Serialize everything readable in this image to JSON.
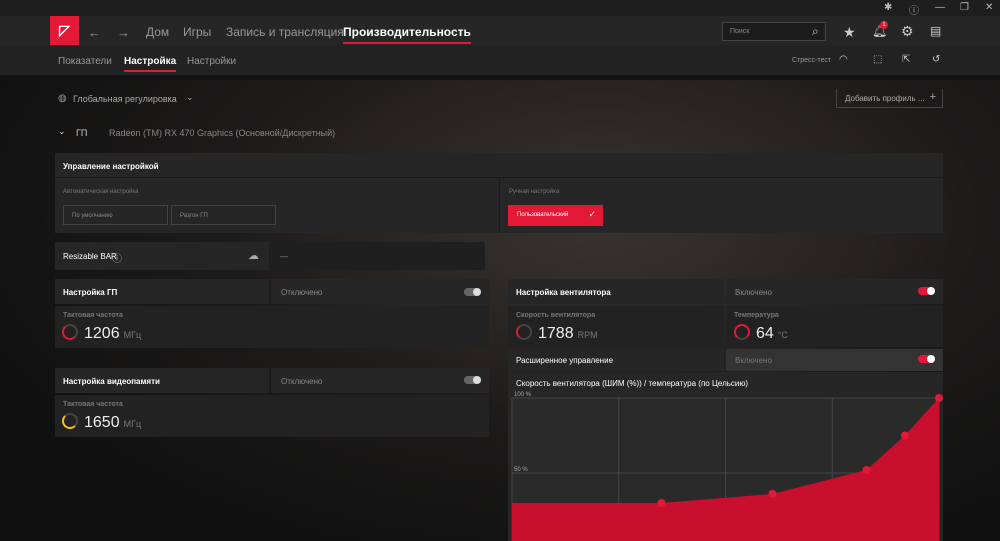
{
  "window": {
    "icons": [
      "bug-icon",
      "help-icon",
      "minimize-icon",
      "restore-icon",
      "close-icon"
    ]
  },
  "nav": {
    "items": [
      "Дом",
      "Игры",
      "Запись и трансляция",
      "Производительность"
    ],
    "active": 3,
    "search_placeholder": "Поиск",
    "notifications": "1"
  },
  "subnav": {
    "items": [
      "Показатели",
      "Настройка",
      "Настройки"
    ],
    "active": 1,
    "stress_test": "Стресс-тест"
  },
  "profile": {
    "scope": "Глобальная регулировка",
    "add_profile": "Добавить профиль ...",
    "gpu_label": "ГП",
    "gpu_name": "Radeon (TM) RX 470 Graphics (Основной/Дискретный)"
  },
  "tuning_control": {
    "title": "Управление настройкой",
    "auto_label": "Автоматическая настройка",
    "auto_options": [
      "По умолчанию",
      "Разгон ГП"
    ],
    "manual_label": "Ручная настройка",
    "manual_option": "Пользовательский"
  },
  "resizable_bar": {
    "label": "Resizable BAR",
    "value": "—"
  },
  "gpu_tuning": {
    "title": "Настройка ГП",
    "state": "Отключено",
    "clock_label": "Тактовая частота",
    "clock": "1206",
    "unit": "МГц"
  },
  "vram_tuning": {
    "title": "Настройка видеопамяти",
    "state": "Отключено",
    "clock_label": "Тактовая частота",
    "clock": "1650",
    "unit": "МГц"
  },
  "fan_tuning": {
    "title": "Настройка вентилятора",
    "state": "Включено",
    "speed_label": "Скорость вентилятора",
    "speed": "1788",
    "speed_unit": "RPM",
    "temp_label": "Температура",
    "temp": "64",
    "temp_unit": "°C",
    "advanced_label": "Расширенное управление",
    "advanced_state": "Включено"
  },
  "chart_data": {
    "type": "area",
    "title": "Скорость вентилятора (ШИМ (%)) / температура (по Цельсию)",
    "y_ticks": [
      "100 %",
      "50 %"
    ],
    "ylim": [
      0,
      100
    ],
    "color": "#c8102e",
    "points": [
      {
        "x": 0,
        "y": 30
      },
      {
        "x": 35,
        "y": 30
      },
      {
        "x": 61,
        "y": 36
      },
      {
        "x": 83,
        "y": 52
      },
      {
        "x": 92,
        "y": 75
      },
      {
        "x": 100,
        "y": 100
      }
    ]
  }
}
